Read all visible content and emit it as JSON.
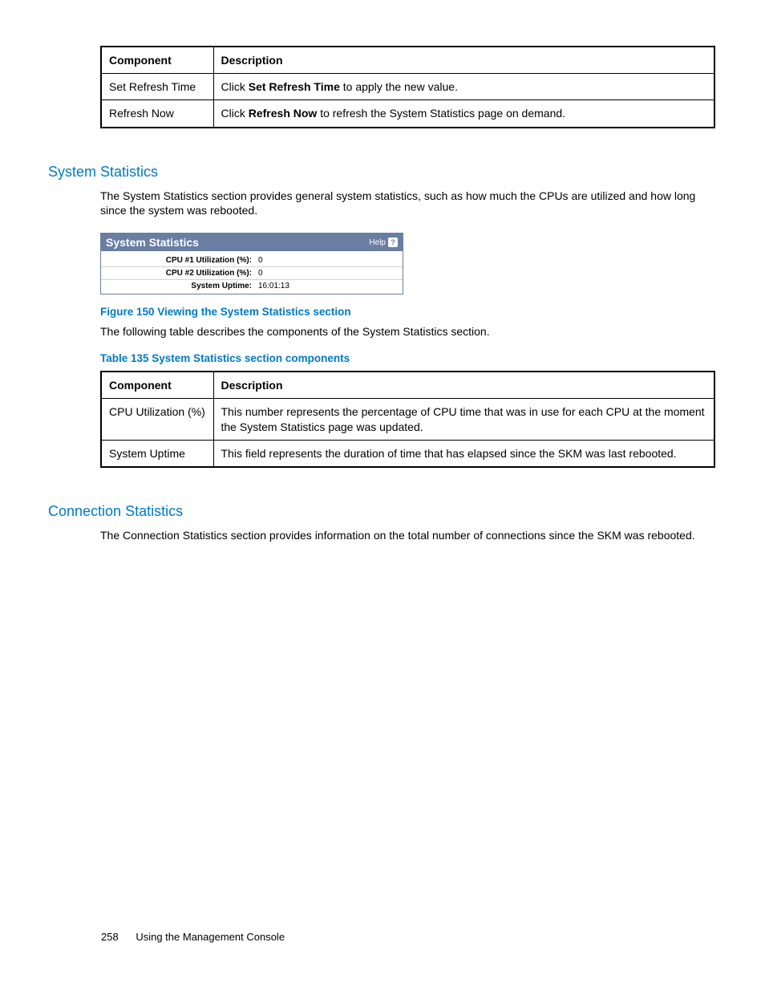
{
  "table1": {
    "headers": [
      "Component",
      "Description"
    ],
    "rows": [
      {
        "component": "Set Refresh Time",
        "desc_prefix": "Click ",
        "desc_bold": "Set Refresh Time",
        "desc_suffix": " to apply the new value."
      },
      {
        "component": "Refresh Now",
        "desc_prefix": "Click ",
        "desc_bold": "Refresh Now",
        "desc_suffix": " to refresh the System Statistics page on demand."
      }
    ]
  },
  "section1": {
    "heading": "System Statistics",
    "para": "The System Statistics section provides general system statistics, such as how much the CPUs are utilized and how long since the system was rebooted."
  },
  "widget": {
    "title": "System Statistics",
    "help": "Help",
    "help_glyph": "?",
    "rows": [
      {
        "label": "CPU #1 Utilization (%):",
        "value": "0"
      },
      {
        "label": "CPU #2 Utilization (%):",
        "value": "0"
      },
      {
        "label": "System Uptime:",
        "value": "16:01:13"
      }
    ]
  },
  "figure_caption": "Figure 150 Viewing the System Statistics section",
  "para_after_fig": "The following table describes the components of the System Statistics section.",
  "table2_caption": "Table 135 System Statistics section components",
  "table2": {
    "headers": [
      "Component",
      "Description"
    ],
    "rows": [
      {
        "component": "CPU Utilization (%)",
        "description": "This number represents the percentage of CPU time that was in use for each CPU at the moment the System Statistics page was updated."
      },
      {
        "component": "System Uptime",
        "description": "This field represents the duration of time that has elapsed since the SKM was last rebooted."
      }
    ]
  },
  "section2": {
    "heading": "Connection Statistics",
    "para": "The Connection Statistics section provides information on the total number of connections since the SKM was rebooted."
  },
  "footer": {
    "page_number": "258",
    "chapter": "Using the Management Console"
  }
}
